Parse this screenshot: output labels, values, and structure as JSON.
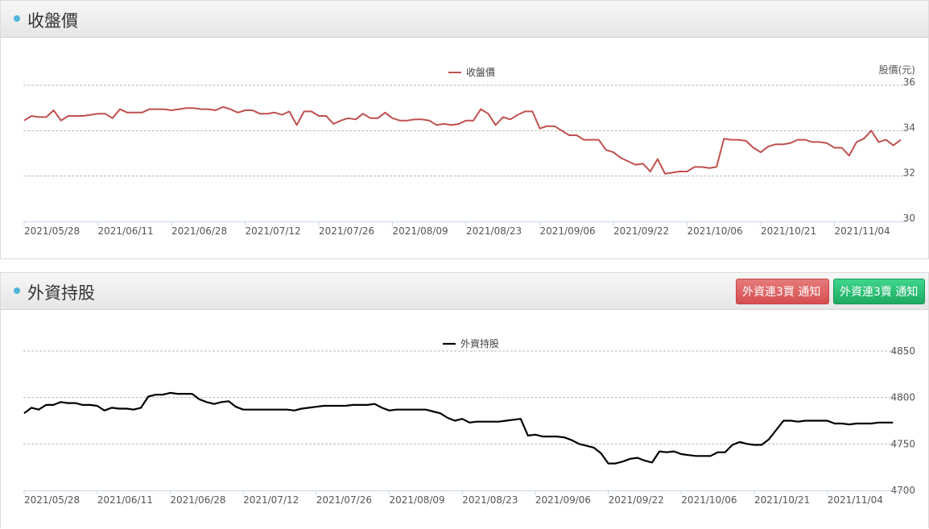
{
  "panels": [
    {
      "title": "收盤價",
      "chart_data": {
        "type": "line",
        "series": [
          {
            "name": "收盤價",
            "color": "#c0504d",
            "values": [
              34.45,
              34.65,
              34.6,
              34.6,
              34.9,
              34.45,
              34.65,
              34.65,
              34.65,
              34.7,
              34.75,
              34.75,
              34.55,
              34.95,
              34.8,
              34.8,
              34.8,
              34.95,
              34.95,
              34.95,
              34.9,
              34.95,
              35,
              35,
              34.95,
              34.95,
              34.9,
              35.05,
              34.95,
              34.8,
              34.9,
              34.9,
              34.75,
              34.75,
              34.8,
              34.7,
              34.85,
              34.25,
              34.85,
              34.85,
              34.65,
              34.65,
              34.3,
              34.45,
              34.55,
              34.5,
              34.75,
              34.55,
              34.55,
              34.8,
              34.55,
              34.45,
              34.45,
              34.5,
              34.5,
              34.45,
              34.25,
              34.3,
              34.25,
              34.3,
              34.45,
              34.45,
              34.95,
              34.75,
              34.25,
              34.6,
              34.5,
              34.7,
              34.85,
              34.85,
              34.1,
              34.2,
              34.2,
              34,
              33.8,
              33.8,
              33.6,
              33.6,
              33.6,
              33.15,
              33.05,
              32.8,
              32.65,
              32.5,
              32.55,
              32.2,
              32.75,
              32.1,
              32.15,
              32.2,
              32.2,
              32.4,
              32.4,
              32.35,
              32.4,
              33.65,
              33.6,
              33.6,
              33.55,
              33.25,
              33.05,
              33.3,
              33.4,
              33.4,
              33.45,
              33.6,
              33.6,
              33.5,
              33.5,
              33.45,
              33.25,
              33.25,
              32.9,
              33.5,
              33.65,
              34,
              33.5,
              33.6,
              33.35,
              33.6
            ]
          }
        ],
        "x_tick_labels": [
          "2021/05/28",
          "2021/06/11",
          "2021/06/28",
          "2021/07/12",
          "2021/07/26",
          "2021/08/09",
          "2021/08/23",
          "2021/09/06",
          "2021/09/22",
          "2021/10/06",
          "2021/10/21",
          "2021/11/04"
        ],
        "x_tick_index": [
          0,
          10,
          20,
          30,
          40,
          50,
          60,
          70,
          80,
          90,
          100,
          110
        ],
        "y_ticks": [
          30,
          32,
          34,
          36
        ],
        "ylim": [
          30,
          36
        ],
        "ylabel": "股價(元)",
        "grid": true,
        "legend": "top-center"
      }
    },
    {
      "title": "外資持股",
      "buttons": [
        {
          "label": "外資連3買 通知",
          "color": "#d9534f"
        },
        {
          "label": "外資連3賣 通知",
          "color": "#22b36a"
        }
      ],
      "chart_data": {
        "type": "line",
        "series": [
          {
            "name": "外資持股",
            "color": "#000000",
            "values": [
              4783,
              4789,
              4787,
              4792,
              4792,
              4795,
              4794,
              4794,
              4792,
              4792,
              4791,
              4786,
              4789,
              4788,
              4788,
              4787,
              4789,
              4801,
              4803,
              4803,
              4805,
              4804,
              4804,
              4804,
              4798,
              4795,
              4793,
              4795,
              4796,
              4790,
              4787,
              4787,
              4787,
              4787,
              4787,
              4787,
              4787,
              4786,
              4788,
              4789,
              4790,
              4791,
              4791,
              4791,
              4791,
              4792,
              4792,
              4792,
              4793,
              4789,
              4786,
              4787,
              4787,
              4787,
              4787,
              4787,
              4785,
              4783,
              4778,
              4775,
              4777,
              4773,
              4774,
              4774,
              4774,
              4774,
              4775,
              4776,
              4777,
              4759,
              4760,
              4758,
              4758,
              4758,
              4757,
              4754,
              4750,
              4748,
              4746,
              4740,
              4729,
              4729,
              4731,
              4734,
              4735,
              4732,
              4730,
              4742,
              4741,
              4742,
              4739,
              4738,
              4737,
              4737,
              4737,
              4741,
              4741,
              4749,
              4752,
              4750,
              4749,
              4749,
              4755,
              4765,
              4775,
              4775,
              4774,
              4775,
              4775,
              4775,
              4775,
              4772,
              4772,
              4771,
              4772,
              4772,
              4772,
              4773,
              4773,
              4773
            ]
          }
        ],
        "x_tick_labels": [
          "2021/05/28",
          "2021/06/11",
          "2021/06/28",
          "2021/07/12",
          "2021/07/26",
          "2021/08/09",
          "2021/08/23",
          "2021/09/06",
          "2021/09/22",
          "2021/10/06",
          "2021/10/21",
          "2021/11/04"
        ],
        "x_tick_index": [
          0,
          10,
          20,
          30,
          40,
          50,
          60,
          70,
          80,
          90,
          100,
          110
        ],
        "y_ticks": [
          4700,
          4750,
          4800,
          4850
        ],
        "ylim": [
          4700,
          4850
        ],
        "grid": true,
        "legend": "top-center"
      }
    }
  ]
}
